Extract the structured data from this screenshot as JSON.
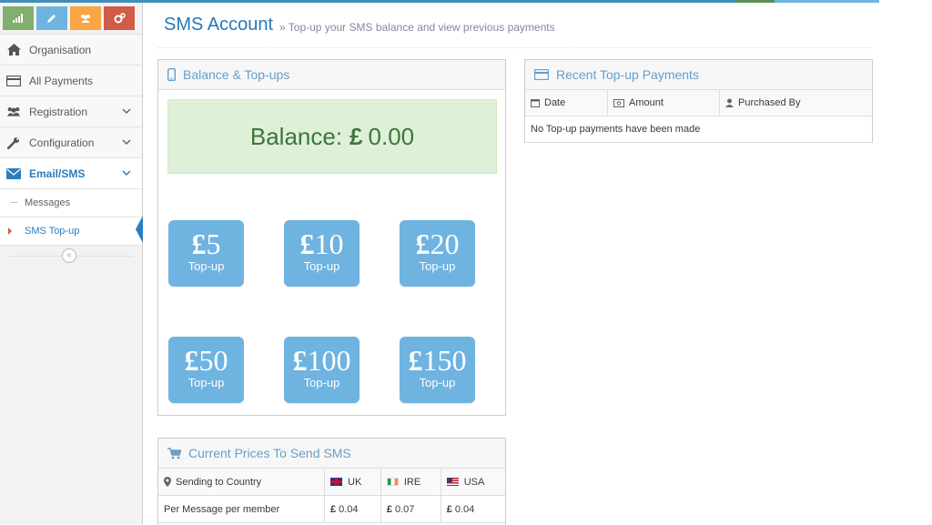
{
  "page": {
    "title": "SMS Account",
    "subtitle": "» Top-up your SMS balance and view previous payments"
  },
  "sidebar": {
    "shortcuts": [
      {
        "icon": "signal-icon",
        "color": "#82af6f"
      },
      {
        "icon": "pencil-icon",
        "color": "#6fb3e0"
      },
      {
        "icon": "users-icon",
        "color": "#f8a542"
      },
      {
        "icon": "cogs-icon",
        "color": "#d15b47"
      }
    ],
    "items": [
      {
        "label": "Organisation",
        "icon": "home-icon"
      },
      {
        "label": "All Payments",
        "icon": "credit-card-icon"
      },
      {
        "label": "Registration",
        "icon": "users-icon"
      },
      {
        "label": "Configuration",
        "icon": "wrench-icon"
      },
      {
        "label": "Email/SMS",
        "icon": "envelope-icon"
      }
    ],
    "subitems": [
      {
        "label": "Messages"
      },
      {
        "label": "SMS Top-up"
      }
    ],
    "collapse_glyph": "«"
  },
  "balance": {
    "heading": "Balance & Top-ups",
    "label": "Balance:",
    "currency": "£",
    "value": "0.00"
  },
  "topups": [
    {
      "currency": "£",
      "amount": "5",
      "label": "Top-up"
    },
    {
      "currency": "£",
      "amount": "10",
      "label": "Top-up"
    },
    {
      "currency": "£",
      "amount": "20",
      "label": "Top-up"
    },
    {
      "currency": "£",
      "amount": "50",
      "label": "Top-up"
    },
    {
      "currency": "£",
      "amount": "100",
      "label": "Top-up"
    },
    {
      "currency": "£",
      "amount": "150",
      "label": "Top-up"
    }
  ],
  "prices": {
    "heading": "Current Prices To Send SMS",
    "row_header": "Sending to Country",
    "row_label": "Per Message per member",
    "countries": [
      {
        "name": "UK",
        "flag": "uk-flag-icon",
        "currency": "£",
        "price": "0.04"
      },
      {
        "name": "IRE",
        "flag": "ireland-flag-icon",
        "currency": "£",
        "price": "0.07"
      },
      {
        "name": "USA",
        "flag": "usa-flag-icon",
        "currency": "£",
        "price": "0.04"
      }
    ]
  },
  "recent": {
    "heading": "Recent Top-up Payments",
    "columns": [
      "Date",
      "Amount",
      "Purchased By"
    ],
    "empty_message": "No Top-up payments have been made"
  },
  "colors": {
    "accent": "#2679b5",
    "box_heading": "#669fc7",
    "topup_button": "#6fb3e0",
    "balance_bg": "#dff0d8",
    "balance_text": "#3c763d"
  }
}
